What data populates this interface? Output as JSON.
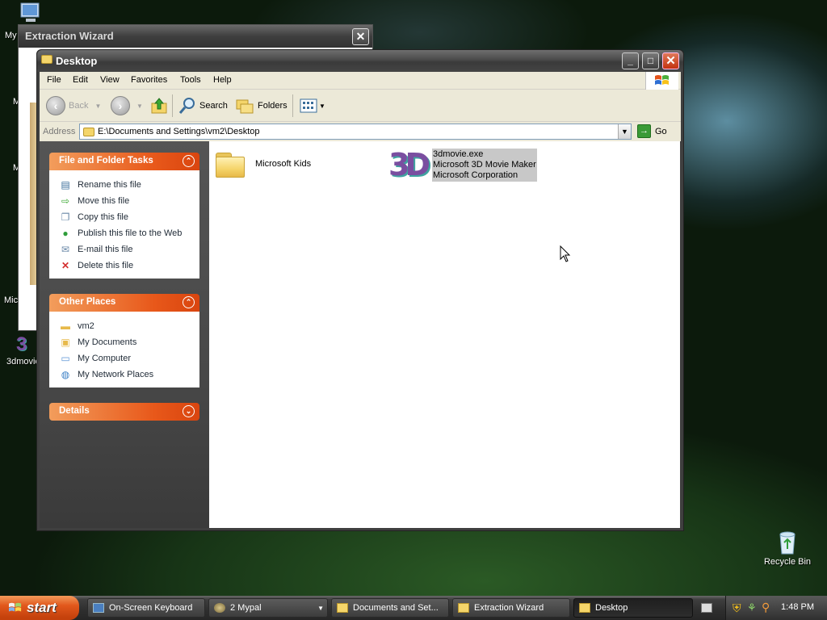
{
  "desktop": {
    "icons": [
      {
        "label": "My",
        "name": "my-computer"
      },
      {
        "label": "3dmovie",
        "name": "3dmovie"
      },
      {
        "label": "Recycle Bin",
        "name": "recycle-bin"
      },
      {
        "label": "Micr",
        "name": "microsoft-partial"
      },
      {
        "label": "M",
        "name": "partial-m1"
      },
      {
        "label": "M",
        "name": "partial-m2"
      }
    ]
  },
  "wizard": {
    "title": "Extraction Wizard",
    "close_label": "✕"
  },
  "explorer": {
    "title": "Desktop",
    "controls": {
      "minimize": "_",
      "maximize": "□",
      "close": "✕"
    },
    "menu": [
      "File",
      "Edit",
      "View",
      "Favorites",
      "Tools",
      "Help"
    ],
    "toolbar": {
      "back": "Back",
      "search": "Search",
      "folders": "Folders"
    },
    "address": {
      "label": "Address",
      "value": "E:\\Documents and Settings\\vm2\\Desktop",
      "go": "Go"
    },
    "panels": {
      "file_tasks": {
        "title": "File and Folder Tasks",
        "items": [
          {
            "label": "Rename this file",
            "icon": "rename-icon"
          },
          {
            "label": "Move this file",
            "icon": "move-icon"
          },
          {
            "label": "Copy this file",
            "icon": "copy-icon"
          },
          {
            "label": "Publish this file to the Web",
            "icon": "publish-icon"
          },
          {
            "label": "E-mail this file",
            "icon": "email-icon"
          },
          {
            "label": "Delete this file",
            "icon": "delete-icon"
          }
        ]
      },
      "other_places": {
        "title": "Other Places",
        "items": [
          {
            "label": "vm2",
            "icon": "folder-icon"
          },
          {
            "label": "My Documents",
            "icon": "my-documents-icon"
          },
          {
            "label": "My Computer",
            "icon": "my-computer-icon"
          },
          {
            "label": "My Network Places",
            "icon": "network-places-icon"
          }
        ]
      },
      "details": {
        "title": "Details"
      }
    },
    "files": [
      {
        "name": "Microsoft Kids",
        "type": "folder"
      },
      {
        "name": "3dmovie.exe",
        "description": "Microsoft 3D Movie Maker",
        "company": "Microsoft Corporation",
        "type": "exe",
        "selected": true
      }
    ]
  },
  "taskbar": {
    "start": "start",
    "tasks": [
      {
        "label": "On-Screen Keyboard",
        "icon": "keyboard-icon"
      },
      {
        "label": "2 Mypal",
        "icon": "browser-icon"
      },
      {
        "label": "Documents and Set...",
        "icon": "folder-icon"
      },
      {
        "label": "Extraction Wizard",
        "icon": "folder-icon"
      },
      {
        "label": "Desktop",
        "icon": "folder-icon",
        "active": true
      }
    ],
    "clock": "1:48 PM"
  },
  "colors": {
    "panel_header": "#e8581a",
    "selection": "#c8c8c8",
    "start_button": "#e2581c"
  }
}
